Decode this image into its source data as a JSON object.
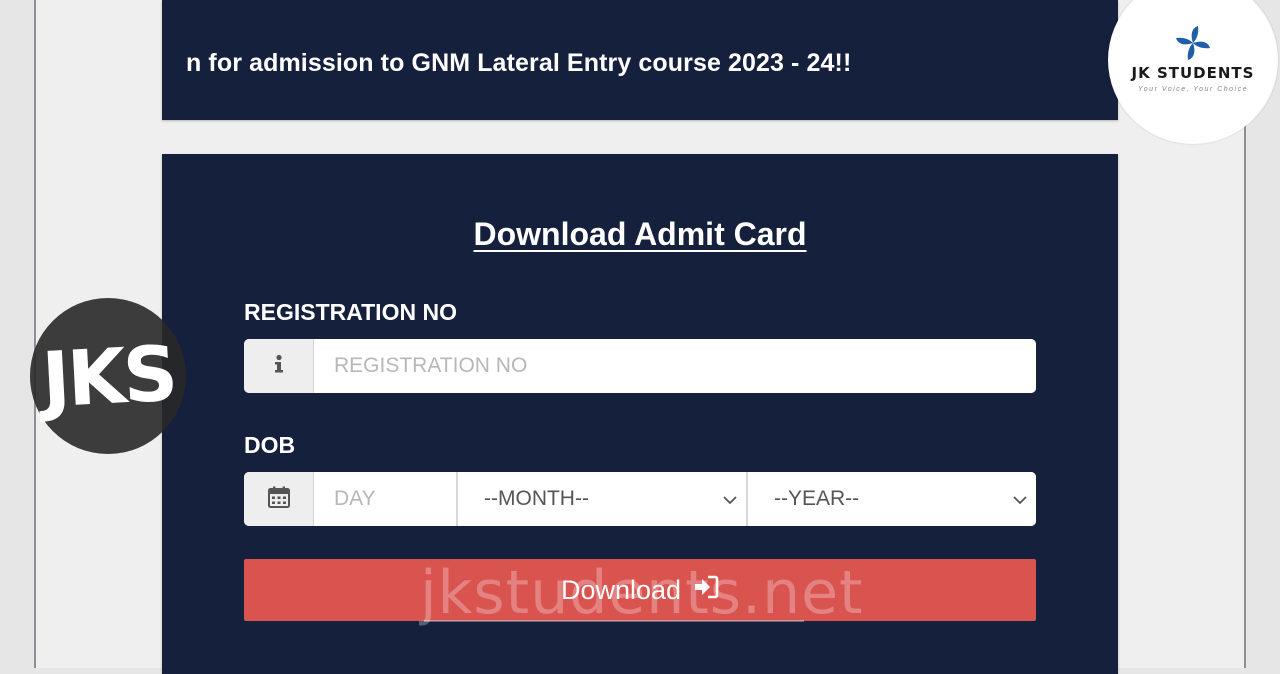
{
  "marquee": {
    "text": "n for admission to GNM Lateral Entry course 2023 - 24!!"
  },
  "form": {
    "title": "Download Admit Card",
    "registration_label": "REGISTRATION NO",
    "registration_placeholder": "REGISTRATION NO",
    "dob_label": "DOB",
    "day_placeholder": "DAY",
    "month_selected": "--MONTH--",
    "year_selected": "--YEAR--",
    "download_label": "Download"
  },
  "watermark": {
    "text": "jkstudents.net",
    "badge": "JKS"
  },
  "logo": {
    "name": "JK STUDENTS",
    "tagline": "Your Voice, Your Choice"
  },
  "colors": {
    "panel": "#15203d",
    "button": "#d9534f",
    "background": "#e6e6e6",
    "logo_blue": "#1f5fa8"
  },
  "icons": {
    "registration_addon": "info-icon",
    "dob_addon": "calendar-icon",
    "button_icon": "sign-in-icon",
    "select_arrow": "chevron-down-icon"
  }
}
